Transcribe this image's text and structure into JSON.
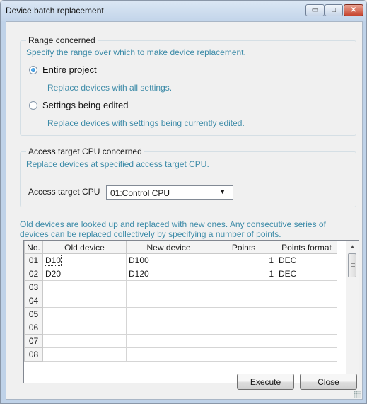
{
  "window": {
    "title": "Device batch replacement",
    "minimize_glyph": "▭",
    "maximize_glyph": "□",
    "close_glyph": "✕"
  },
  "range_group": {
    "legend": "Range concerned",
    "hint": "Specify the range over which to make device replacement.",
    "options": [
      {
        "label": "Entire project",
        "hint": "Replace devices with all settings.",
        "selected": true
      },
      {
        "label": "Settings being edited",
        "hint": "Replace devices with settings being currently edited.",
        "selected": false
      }
    ]
  },
  "access_group": {
    "legend": "Access target CPU concerned",
    "hint": "Replace devices at specified access target CPU.",
    "cpu_label": "Access target CPU",
    "cpu_value": "01:Control CPU",
    "dropdown_glyph": "▼"
  },
  "description": "Old devices are looked up and replaced with new ones. Any consecutive series of devices can be replaced collectively by specifying a number of points.",
  "table": {
    "columns": [
      "No.",
      "Old device",
      "New device",
      "Points",
      "Points format"
    ],
    "rows": [
      {
        "no": "01",
        "old": "D10",
        "new": "D100",
        "points": "1",
        "format": "DEC"
      },
      {
        "no": "02",
        "old": "D20",
        "new": "D120",
        "points": "1",
        "format": "DEC"
      },
      {
        "no": "03",
        "old": "",
        "new": "",
        "points": "",
        "format": ""
      },
      {
        "no": "04",
        "old": "",
        "new": "",
        "points": "",
        "format": ""
      },
      {
        "no": "05",
        "old": "",
        "new": "",
        "points": "",
        "format": ""
      },
      {
        "no": "06",
        "old": "",
        "new": "",
        "points": "",
        "format": ""
      },
      {
        "no": "07",
        "old": "",
        "new": "",
        "points": "",
        "format": ""
      },
      {
        "no": "08",
        "old": "",
        "new": "",
        "points": "",
        "format": ""
      }
    ],
    "scroll_up_glyph": "▲",
    "scroll_down_glyph": "▼"
  },
  "buttons": {
    "execute": "Execute",
    "close": "Close"
  }
}
